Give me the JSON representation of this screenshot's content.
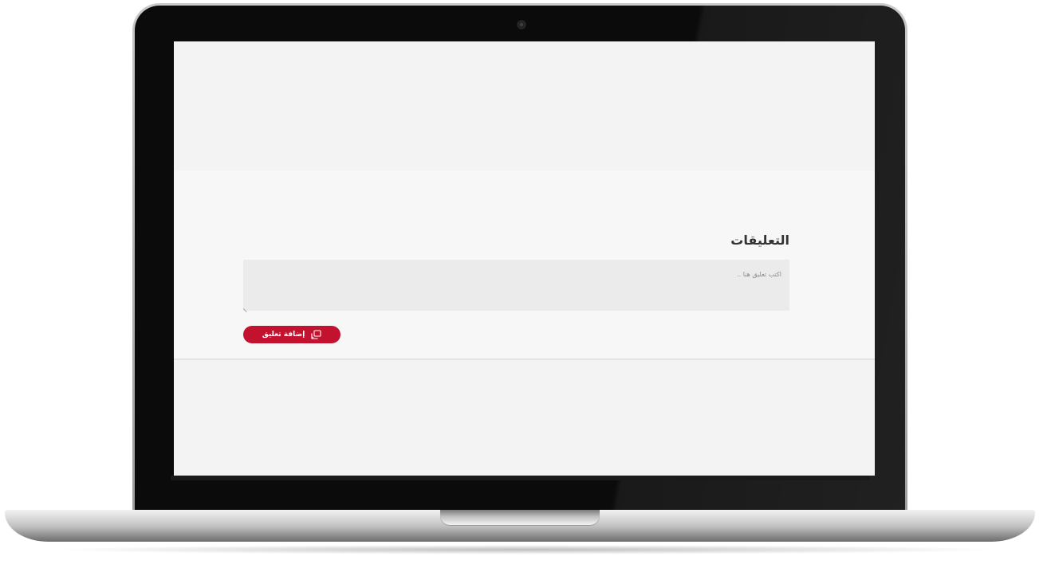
{
  "comments": {
    "title": "التعليقات",
    "input_placeholder": "اكتب تعليق هنا ..",
    "input_value": "",
    "add_button_label": "إضافة تعليق",
    "add_button_icon": "comment-add-icon"
  },
  "colors": {
    "accent": "#c3122f",
    "screen_background": "#f3f3f3",
    "section_background": "#f7f7f7",
    "input_background": "#ebebec"
  }
}
